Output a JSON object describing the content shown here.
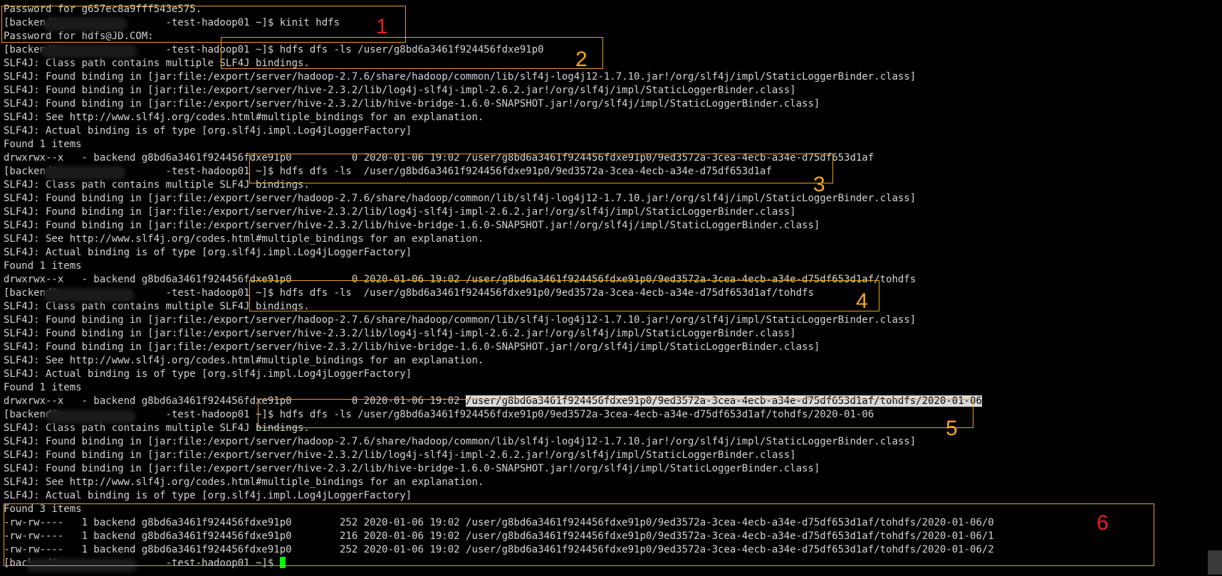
{
  "colors": {
    "background": "#000000",
    "text": "#d4d4d4",
    "cursor": "#00ff00",
    "annotation_box": "#e6a11c",
    "annotation_number_red": "#e52222",
    "annotation_number_orange": "#f5a623",
    "selection": "#d9d9d9"
  },
  "terminal": {
    "lines": [
      {
        "text": "Password for g657ec8a9fff543e575."
      },
      {
        "text": "[backend@                  -test-hadoop01 ~]$ kinit hdfs"
      },
      {
        "text": "Password for hdfs@JD.COM:"
      },
      {
        "text": "[backend@                  -test-hadoop01 ~]$ hdfs dfs -ls /user/g8bd6a3461f924456fdxe91p0"
      },
      {
        "text": "SLF4J: Class path contains multiple SLF4J bindings."
      },
      {
        "text": "SLF4J: Found binding in [jar:file:/export/server/hadoop-2.7.6/share/hadoop/common/lib/slf4j-log4j12-1.7.10.jar!/org/slf4j/impl/StaticLoggerBinder.class]"
      },
      {
        "text": "SLF4J: Found binding in [jar:file:/export/server/hive-2.3.2/lib/log4j-slf4j-impl-2.6.2.jar!/org/slf4j/impl/StaticLoggerBinder.class]"
      },
      {
        "text": "SLF4J: Found binding in [jar:file:/export/server/hive-2.3.2/lib/hive-bridge-1.6.0-SNAPSHOT.jar!/org/slf4j/impl/StaticLoggerBinder.class]"
      },
      {
        "text": "SLF4J: See http://www.slf4j.org/codes.html#multiple_bindings for an explanation."
      },
      {
        "text": "SLF4J: Actual binding is of type [org.slf4j.impl.Log4jLoggerFactory]"
      },
      {
        "text": "Found 1 items"
      },
      {
        "text": "drwxrwx--x   - backend g8bd6a3461f924456fdxe91p0          0 2020-01-06 19:02 /user/g8bd6a3461f924456fdxe91p0/9ed3572a-3cea-4ecb-a34e-d75df653d1af"
      },
      {
        "text": "[backend@                  -test-hadoop01 ~]$ hdfs dfs -ls  /user/g8bd6a3461f924456fdxe91p0/9ed3572a-3cea-4ecb-a34e-d75df653d1af"
      },
      {
        "text": "SLF4J: Class path contains multiple SLF4J bindings."
      },
      {
        "text": "SLF4J: Found binding in [jar:file:/export/server/hadoop-2.7.6/share/hadoop/common/lib/slf4j-log4j12-1.7.10.jar!/org/slf4j/impl/StaticLoggerBinder.class]"
      },
      {
        "text": "SLF4J: Found binding in [jar:file:/export/server/hive-2.3.2/lib/log4j-slf4j-impl-2.6.2.jar!/org/slf4j/impl/StaticLoggerBinder.class]"
      },
      {
        "text": "SLF4J: Found binding in [jar:file:/export/server/hive-2.3.2/lib/hive-bridge-1.6.0-SNAPSHOT.jar!/org/slf4j/impl/StaticLoggerBinder.class]"
      },
      {
        "text": "SLF4J: See http://www.slf4j.org/codes.html#multiple_bindings for an explanation."
      },
      {
        "text": "SLF4J: Actual binding is of type [org.slf4j.impl.Log4jLoggerFactory]"
      },
      {
        "text": "Found 1 items"
      },
      {
        "text": "drwxrwx--x   - backend g8bd6a3461f924456fdxe91p0          0 2020-01-06 19:02 /user/g8bd6a3461f924456fdxe91p0/9ed3572a-3cea-4ecb-a34e-d75df653d1af/tohdfs"
      },
      {
        "text": "[backend@                  -test-hadoop01 ~]$ hdfs dfs -ls  /user/g8bd6a3461f924456fdxe91p0/9ed3572a-3cea-4ecb-a34e-d75df653d1af/tohdfs"
      },
      {
        "text": "SLF4J: Class path contains multiple SLF4J bindings."
      },
      {
        "text": "SLF4J: Found binding in [jar:file:/export/server/hadoop-2.7.6/share/hadoop/common/lib/slf4j-log4j12-1.7.10.jar!/org/slf4j/impl/StaticLoggerBinder.class]"
      },
      {
        "text": "SLF4J: Found binding in [jar:file:/export/server/hive-2.3.2/lib/log4j-slf4j-impl-2.6.2.jar!/org/slf4j/impl/StaticLoggerBinder.class]"
      },
      {
        "text": "SLF4J: Found binding in [jar:file:/export/server/hive-2.3.2/lib/hive-bridge-1.6.0-SNAPSHOT.jar!/org/slf4j/impl/StaticLoggerBinder.class]"
      },
      {
        "text": "SLF4J: See http://www.slf4j.org/codes.html#multiple_bindings for an explanation."
      },
      {
        "text": "SLF4J: Actual binding is of type [org.slf4j.impl.Log4jLoggerFactory]"
      },
      {
        "text": "Found 1 items"
      },
      {
        "text": "drwxrwx--x   - backend g8bd6a3461f924456fdxe91p0          0 2020-01-06 19:02 ",
        "highlight": "/user/g8bd6a3461f924456fdxe91p0/9ed3572a-3cea-4ecb-a34e-d75df653d1af/tohdfs/2020-01-06"
      },
      {
        "text": "[backend@                  -test-hadoop01 ~]$ hdfs dfs -ls /user/g8bd6a3461f924456fdxe91p0/9ed3572a-3cea-4ecb-a34e-d75df653d1af/tohdfs/2020-01-06"
      },
      {
        "text": "SLF4J: Class path contains multiple SLF4J bindings."
      },
      {
        "text": "SLF4J: Found binding in [jar:file:/export/server/hadoop-2.7.6/share/hadoop/common/lib/slf4j-log4j12-1.7.10.jar!/org/slf4j/impl/StaticLoggerBinder.class]"
      },
      {
        "text": "SLF4J: Found binding in [jar:file:/export/server/hive-2.3.2/lib/log4j-slf4j-impl-2.6.2.jar!/org/slf4j/impl/StaticLoggerBinder.class]"
      },
      {
        "text": "SLF4J: Found binding in [jar:file:/export/server/hive-2.3.2/lib/hive-bridge-1.6.0-SNAPSHOT.jar!/org/slf4j/impl/StaticLoggerBinder.class]"
      },
      {
        "text": "SLF4J: See http://www.slf4j.org/codes.html#multiple_bindings for an explanation."
      },
      {
        "text": "SLF4J: Actual binding is of type [org.slf4j.impl.Log4jLoggerFactory]"
      },
      {
        "text": "Found 3 items"
      },
      {
        "text": "-rw-rw----   1 backend g8bd6a3461f924456fdxe91p0        252 2020-01-06 19:02 /user/g8bd6a3461f924456fdxe91p0/9ed3572a-3cea-4ecb-a34e-d75df653d1af/tohdfs/2020-01-06/0"
      },
      {
        "text": "-rw-rw----   1 backend g8bd6a3461f924456fdxe91p0        216 2020-01-06 19:02 /user/g8bd6a3461f924456fdxe91p0/9ed3572a-3cea-4ecb-a34e-d75df653d1af/tohdfs/2020-01-06/1"
      },
      {
        "text": "-rw-rw----   1 backend g8bd6a3461f924456fdxe91p0        252 2020-01-06 19:02 /user/g8bd6a3461f924456fdxe91p0/9ed3572a-3cea-4ecb-a34e-d75df653d1af/tohdfs/2020-01-06/2"
      },
      {
        "text": "[backend@                  -test-hadoop01 ~]$ ",
        "cursor": true
      }
    ]
  },
  "annotations": [
    {
      "label": "1",
      "color": "#e52222"
    },
    {
      "label": "2",
      "color": "#f5a623"
    },
    {
      "label": "3",
      "color": "#f5a623"
    },
    {
      "label": "4",
      "color": "#f5a623"
    },
    {
      "label": "5",
      "color": "#f5a623"
    },
    {
      "label": "6",
      "color": "#e52222"
    }
  ]
}
